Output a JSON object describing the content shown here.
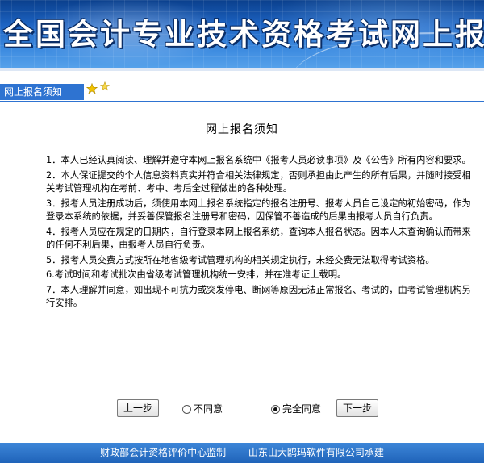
{
  "banner": {
    "title": "全国会计专业技术资格考试网上报名系"
  },
  "nav": {
    "tab_label": "网上报名须知"
  },
  "notice": {
    "heading": "网上报名须知",
    "items": [
      "1．本人已经认真阅读、理解并遵守本网上报名系统中《报考人员必读事项》及《公告》所有内容和要求。",
      "2．本人保证提交的个人信息资料真实并符合相关法律规定，否则承担由此产生的所有后果，并随时接受相关考试管理机构在考前、考中、考后全过程做出的各种处理。",
      "3．报考人员注册成功后，须使用本网上报名系统指定的报名注册号、报考人员自己设定的初始密码，作为登录本系统的依据，并妥善保管报名注册号和密码，因保管不善造成的后果由报考人员自行负责。",
      "4．报考人员应在规定的日期内，自行登录本网上报名系统，查询本人报名状态。因本人未查询确认而带来的任何不利后果，由报考人员自行负责。",
      "5．报考人员交费方式按所在地省级考试管理机构的相关规定执行，未经交费无法取得考试资格。",
      "6.考试时间和考试批次由省级考试管理机构统一安排，并在准考证上载明。",
      "7．本人理解并同意，如出现不可抗力或突发停电、断网等原因无法正常报名、考试的，由考试管理机构另行安排。"
    ]
  },
  "controls": {
    "prev_label": "上一步",
    "disagree_label": "不同意",
    "agree_label": "完全同意",
    "next_label": "下一步",
    "selected": "agree"
  },
  "footer": {
    "supervisor": "财政部会计资格评价中心监制",
    "developer": "山东山大鸥玛软件有限公司承建"
  },
  "colors": {
    "accent": "#2e73d1",
    "star": "#f2c200"
  }
}
